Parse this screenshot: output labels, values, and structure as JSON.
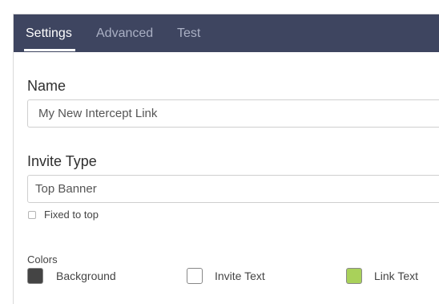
{
  "tabs": [
    {
      "label": "Settings",
      "active": true
    },
    {
      "label": "Advanced",
      "active": false
    },
    {
      "label": "Test",
      "active": false
    }
  ],
  "name_field": {
    "label": "Name",
    "value": "My New Intercept Link"
  },
  "invite_type": {
    "label": "Invite Type",
    "selected": "Top Banner"
  },
  "fixed_to_top": {
    "label": "Fixed to top",
    "checked": false
  },
  "colors": {
    "label": "Colors",
    "items": [
      {
        "label": "Background",
        "color": "#444444"
      },
      {
        "label": "Invite Text",
        "color": "#ffffff"
      },
      {
        "label": "Link Text",
        "color": "#a9d15a"
      }
    ]
  },
  "theme": {
    "tabbar_bg": "#3e4560",
    "tab_active": "#ffffff",
    "tab_inactive": "#aab0c4"
  }
}
